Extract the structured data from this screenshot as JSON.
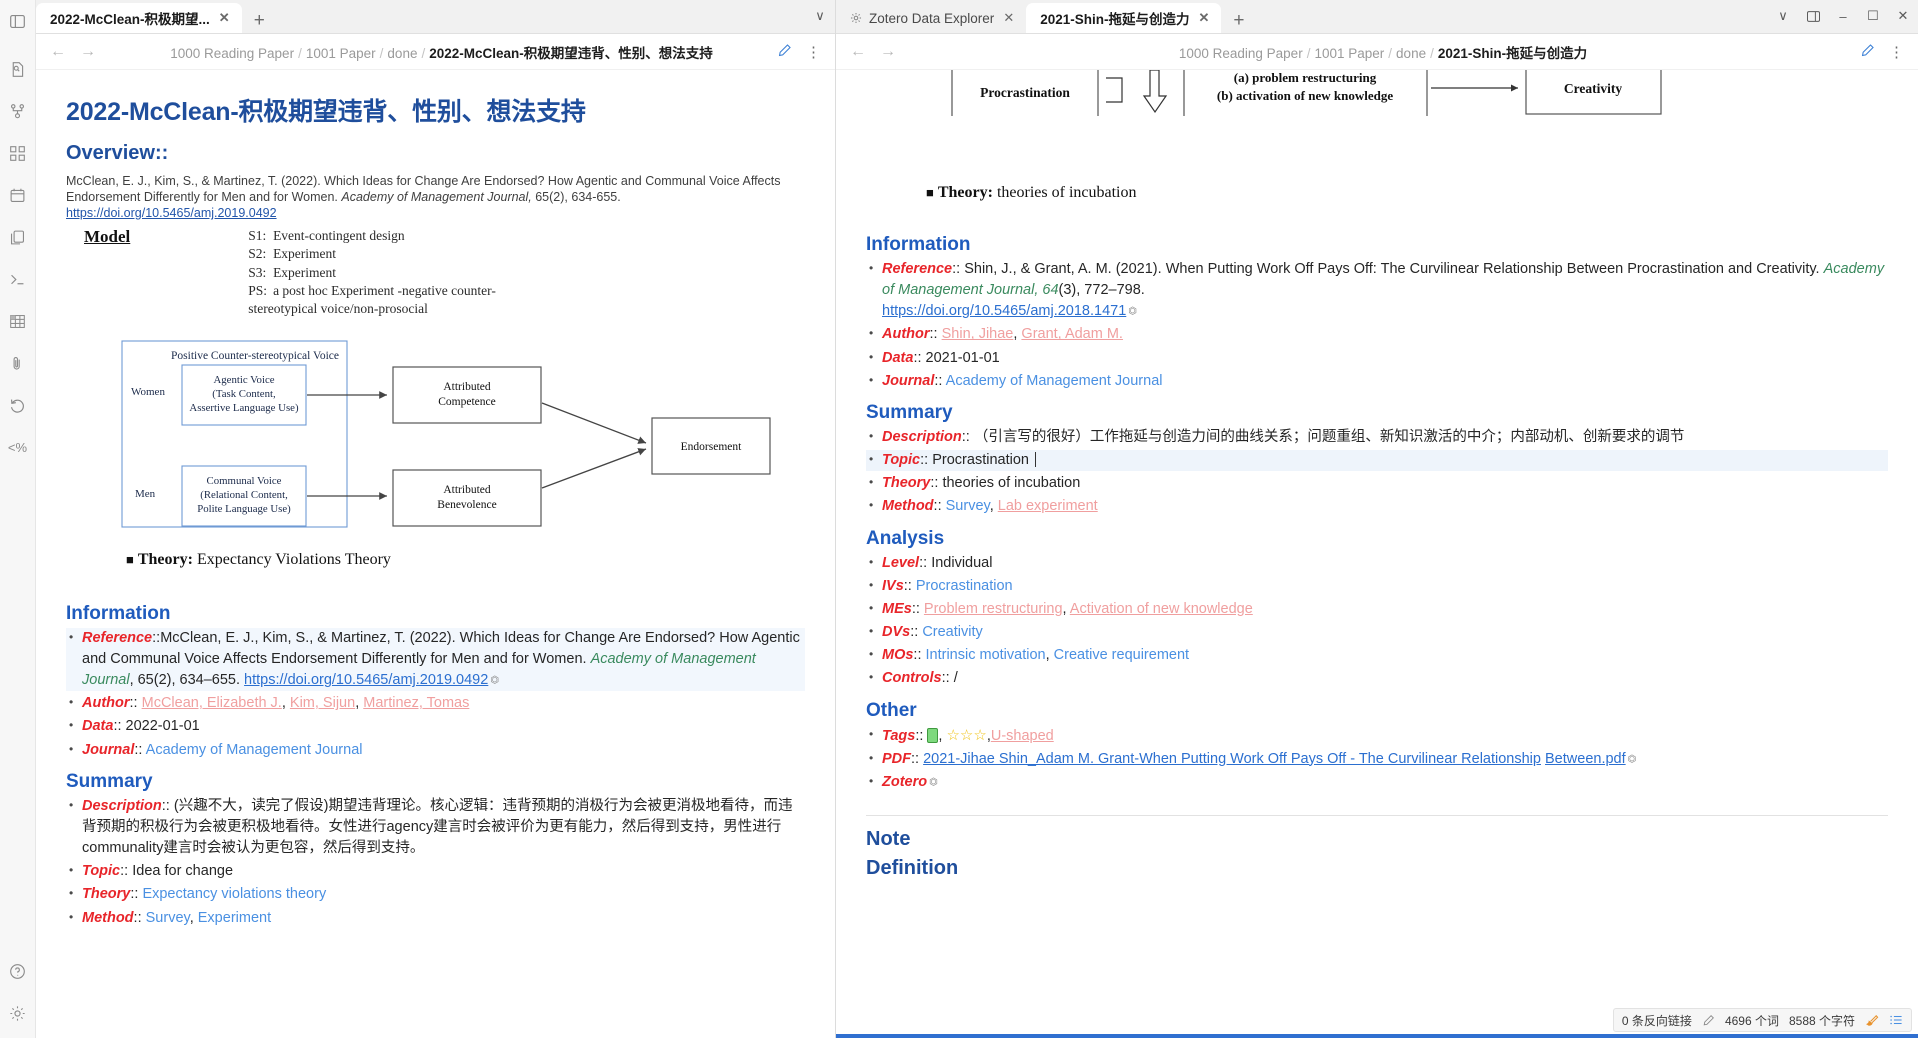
{
  "rail": {
    "icons": [
      {
        "name": "file-search-icon",
        "label": "Quick switcher"
      },
      {
        "name": "graph-icon",
        "label": "Graph view"
      },
      {
        "name": "canvas-icon",
        "label": "Canvas"
      },
      {
        "name": "calendar-icon",
        "label": "Calendar"
      },
      {
        "name": "copy-files-icon",
        "label": "Templates"
      },
      {
        "name": "terminal-icon",
        "label": "Command"
      },
      {
        "name": "table-icon",
        "label": "Table"
      },
      {
        "name": "attachment-icon",
        "label": "Attachment"
      },
      {
        "name": "undo-history-icon",
        "label": "History"
      },
      {
        "name": "percent-code-icon",
        "label": "Snippet"
      }
    ],
    "bottom_icons": [
      {
        "name": "help-icon",
        "label": "Help"
      },
      {
        "name": "settings-gear-icon",
        "label": "Settings"
      }
    ]
  },
  "left_pane": {
    "tabs": [
      {
        "label": "2022-McClean-积极期望...",
        "active": true,
        "close": "✕"
      }
    ],
    "newtab": "+",
    "chevron": "∨",
    "breadcrumb": {
      "back": "←",
      "forward": "→",
      "parts": [
        "1000 Reading Paper",
        "1001 Paper",
        "done"
      ],
      "current": "2022-McClean-积极期望违背、性别、想法支持",
      "separator": "/",
      "kebab": "⋮"
    },
    "doc": {
      "title": "2022-McClean-积极期望违背、性别、想法支持",
      "overview_heading": "Overview::",
      "citation_line1": "McClean, E. J., Kim, S., & Martinez, T. (2022). Which Ideas for Change Are Endorsed? How Agentic and Communal Voice Affects",
      "citation_line2_pre": "Endorsement Differently for Men and for Women. ",
      "citation_line2_italic": "Academy of Management Journal, ",
      "citation_line2_post": "65(2), 634-655.",
      "citation_doi": "https://doi.org/10.5465/amj.2019.0492",
      "model_label": "Model",
      "studies": [
        {
          "code": "S1:",
          "text": "Event-contingent design"
        },
        {
          "code": "S2:",
          "text": "Experiment"
        },
        {
          "code": "S3:",
          "text": "Experiment"
        },
        {
          "code": "PS:",
          "text": "a post hoc Experiment -negative counter-"
        }
      ],
      "studies_wrap": "stereotypical voice/non-prosocial",
      "diagram": {
        "group_label": "Positive Counter-stereotypical Voice",
        "row1_label": "Women",
        "row2_label": "Men",
        "box1": [
          "Agentic Voice",
          "(Task Content,",
          "Assertive Language Use)"
        ],
        "box2": [
          "Communal Voice",
          "(Relational Content,",
          "Polite Language Use)"
        ],
        "box3": [
          "Attributed",
          "Competence"
        ],
        "box4": [
          "Attributed",
          "Benevolence"
        ],
        "box5": [
          "Endorsement"
        ]
      },
      "theory_marker": "■",
      "theory_label": "Theory:",
      "theory_value": "Expectancy Violations Theory",
      "information_heading": "Information",
      "reference_key": "Reference",
      "reference_sep": "::",
      "reference_text1": "McClean, E. J., Kim, S., & Martinez, T. (2022). Which Ideas for Change Are Endorsed? How",
      "reference_text2": "Agentic and Communal Voice Affects Endorsement Differently for Men and for Women. ",
      "reference_italic1": "Academy of",
      "reference_italic2": "Management Journal",
      "reference_vol": ", 65",
      "reference_pages": "(2), 634–655. ",
      "reference_doi": "https://doi.org/10.5465/amj.2019.0492",
      "author_key": "Author",
      "authors": [
        "McClean, Elizabeth J.",
        "Kim, Sijun",
        "Martinez, Tomas"
      ],
      "data_key": "Data",
      "data_value": "2022-01-01",
      "journal_key": "Journal",
      "journal_value": "Academy of Management Journal",
      "summary_heading": "Summary",
      "description_key": "Description",
      "description_line1": "(兴趣不大，读完了假设)期望违背理论。核心逻辑：违背预期的消极行为会被更消极地看待，而违背",
      "description_line2": "预期的积极行为会被更积极地看待。女性进行agency建言时会被评价为更有能力，然后得到支持，男性进行",
      "description_line3": "communality建言时会被认为更包容，然后得到支持。",
      "topic_key": "Topic",
      "topic_value": "Idea for change",
      "theory_key": "Theory",
      "theory_value2": "Expectancy violations theory",
      "method_key": "Method",
      "method_values": [
        "Survey",
        "Experiment"
      ]
    }
  },
  "right_pane": {
    "tabs": [
      {
        "label": "Zotero Data Explorer",
        "active": false,
        "icon": "gear-icon",
        "close": "✕"
      },
      {
        "label": "2021-Shin-拖延与创造力",
        "active": true,
        "close": "✕"
      }
    ],
    "newtab": "+",
    "window_controls": {
      "chevron": "∨",
      "split": "split-pane-icon",
      "minimize": "–",
      "maximize": "☐",
      "close": "✕"
    },
    "breadcrumb": {
      "back": "←",
      "forward": "→",
      "parts": [
        "1000 Reading Paper",
        "1001 Paper",
        "done"
      ],
      "current": "2021-Shin-拖延与创造力",
      "separator": "/",
      "kebab": "⋮"
    },
    "doc": {
      "diagram": {
        "box1": "Procrastination",
        "box2_line1": "(a) problem restructuring",
        "box2_line2": "(b) activation of new knowledge",
        "box3": "Creativity"
      },
      "theory_marker": "■",
      "theory_label": "Theory:",
      "theory_value": "theories of incubation",
      "information_heading": "Information",
      "reference_key": "Reference",
      "reference_text1": "Shin, J., & Grant, A. M. (2021). When Putting Work Off Pays Off: The Curvilinear Relationship",
      "reference_text2": "Between Procrastination and Creativity. ",
      "reference_italic": "Academy of Management Journal, 64",
      "reference_pages": "(3), 772–798.",
      "reference_doi": "https://doi.org/10.5465/amj.2018.1471",
      "author_key": "Author",
      "authors": [
        "Shin, Jihae",
        "Grant, Adam M."
      ],
      "data_key": "Data",
      "data_value": "2021-01-01",
      "journal_key": "Journal",
      "journal_value": "Academy of Management Journal",
      "summary_heading": "Summary",
      "description_key": "Description",
      "description_line1": "（引言写的很好）工作拖延与创造力间的曲线关系；问题重组、新知识激活的中介；内部动机、创新",
      "description_line2": "要求的调节",
      "topic_key": "Topic",
      "topic_value": "Procrastination",
      "theory_key": "Theory",
      "theory_value2": "theories of incubation",
      "method_key": "Method",
      "method_value_blue": "Survey",
      "method_value_pink": "Lab experiment",
      "analysis_heading": "Analysis",
      "level_key": "Level",
      "level_value": "Individual",
      "ivs_key": "IVs",
      "ivs_value": "Procrastination",
      "mes_key": "MEs",
      "mes_values": [
        "Problem restructuring",
        "Activation of new knowledge"
      ],
      "dvs_key": "DVs",
      "dvs_value": "Creativity",
      "mos_key": "MOs",
      "mos_values": [
        "Intrinsic motivation",
        "Creative requirement"
      ],
      "controls_key": "Controls",
      "controls_value": "/",
      "other_heading": "Other",
      "tags_key": "Tags",
      "tags_stars": "☆☆☆",
      "tags_link": "U-shaped",
      "pdf_key": "PDF",
      "pdf_line1": "2021-Jihae Shin_Adam M. Grant-When Putting Work Off Pays Off - The Curvilinear Relationship",
      "pdf_line2": "Between.pdf",
      "zotero_key": "Zotero",
      "note_heading": "Note",
      "definition_heading": "Definition"
    },
    "statusbar": {
      "backlinks": "0 条反向链接",
      "pencil_icon": "pencil-icon",
      "words": "4696 个词",
      "chars": "8588 个字符",
      "brush_icon": "brush-icon",
      "list_icon": "list-icon"
    }
  }
}
